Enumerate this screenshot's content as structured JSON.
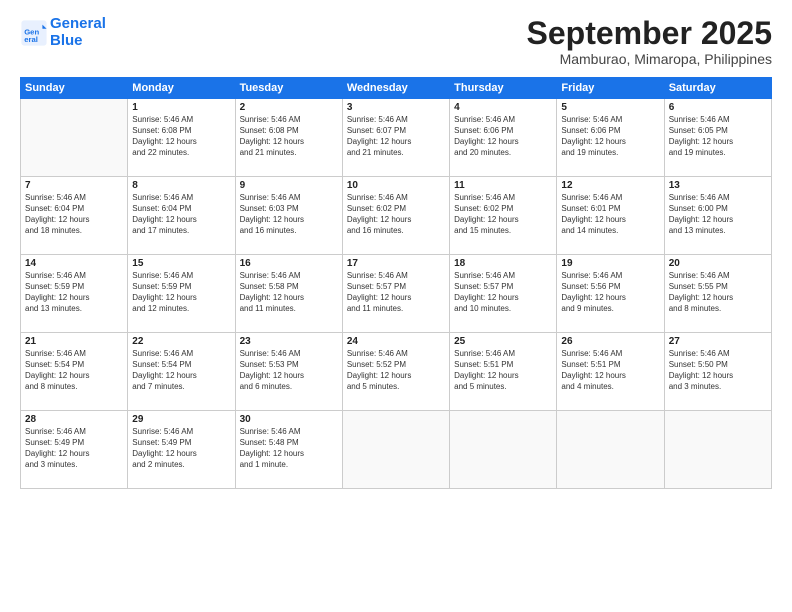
{
  "header": {
    "logo_line1": "General",
    "logo_line2": "Blue",
    "month": "September 2025",
    "location": "Mamburao, Mimaropa, Philippines"
  },
  "weekdays": [
    "Sunday",
    "Monday",
    "Tuesday",
    "Wednesday",
    "Thursday",
    "Friday",
    "Saturday"
  ],
  "weeks": [
    [
      {
        "day": "",
        "info": ""
      },
      {
        "day": "1",
        "info": "Sunrise: 5:46 AM\nSunset: 6:08 PM\nDaylight: 12 hours\nand 22 minutes."
      },
      {
        "day": "2",
        "info": "Sunrise: 5:46 AM\nSunset: 6:08 PM\nDaylight: 12 hours\nand 21 minutes."
      },
      {
        "day": "3",
        "info": "Sunrise: 5:46 AM\nSunset: 6:07 PM\nDaylight: 12 hours\nand 21 minutes."
      },
      {
        "day": "4",
        "info": "Sunrise: 5:46 AM\nSunset: 6:06 PM\nDaylight: 12 hours\nand 20 minutes."
      },
      {
        "day": "5",
        "info": "Sunrise: 5:46 AM\nSunset: 6:06 PM\nDaylight: 12 hours\nand 19 minutes."
      },
      {
        "day": "6",
        "info": "Sunrise: 5:46 AM\nSunset: 6:05 PM\nDaylight: 12 hours\nand 19 minutes."
      }
    ],
    [
      {
        "day": "7",
        "info": "Sunrise: 5:46 AM\nSunset: 6:04 PM\nDaylight: 12 hours\nand 18 minutes."
      },
      {
        "day": "8",
        "info": "Sunrise: 5:46 AM\nSunset: 6:04 PM\nDaylight: 12 hours\nand 17 minutes."
      },
      {
        "day": "9",
        "info": "Sunrise: 5:46 AM\nSunset: 6:03 PM\nDaylight: 12 hours\nand 16 minutes."
      },
      {
        "day": "10",
        "info": "Sunrise: 5:46 AM\nSunset: 6:02 PM\nDaylight: 12 hours\nand 16 minutes."
      },
      {
        "day": "11",
        "info": "Sunrise: 5:46 AM\nSunset: 6:02 PM\nDaylight: 12 hours\nand 15 minutes."
      },
      {
        "day": "12",
        "info": "Sunrise: 5:46 AM\nSunset: 6:01 PM\nDaylight: 12 hours\nand 14 minutes."
      },
      {
        "day": "13",
        "info": "Sunrise: 5:46 AM\nSunset: 6:00 PM\nDaylight: 12 hours\nand 13 minutes."
      }
    ],
    [
      {
        "day": "14",
        "info": "Sunrise: 5:46 AM\nSunset: 5:59 PM\nDaylight: 12 hours\nand 13 minutes."
      },
      {
        "day": "15",
        "info": "Sunrise: 5:46 AM\nSunset: 5:59 PM\nDaylight: 12 hours\nand 12 minutes."
      },
      {
        "day": "16",
        "info": "Sunrise: 5:46 AM\nSunset: 5:58 PM\nDaylight: 12 hours\nand 11 minutes."
      },
      {
        "day": "17",
        "info": "Sunrise: 5:46 AM\nSunset: 5:57 PM\nDaylight: 12 hours\nand 11 minutes."
      },
      {
        "day": "18",
        "info": "Sunrise: 5:46 AM\nSunset: 5:57 PM\nDaylight: 12 hours\nand 10 minutes."
      },
      {
        "day": "19",
        "info": "Sunrise: 5:46 AM\nSunset: 5:56 PM\nDaylight: 12 hours\nand 9 minutes."
      },
      {
        "day": "20",
        "info": "Sunrise: 5:46 AM\nSunset: 5:55 PM\nDaylight: 12 hours\nand 8 minutes."
      }
    ],
    [
      {
        "day": "21",
        "info": "Sunrise: 5:46 AM\nSunset: 5:54 PM\nDaylight: 12 hours\nand 8 minutes."
      },
      {
        "day": "22",
        "info": "Sunrise: 5:46 AM\nSunset: 5:54 PM\nDaylight: 12 hours\nand 7 minutes."
      },
      {
        "day": "23",
        "info": "Sunrise: 5:46 AM\nSunset: 5:53 PM\nDaylight: 12 hours\nand 6 minutes."
      },
      {
        "day": "24",
        "info": "Sunrise: 5:46 AM\nSunset: 5:52 PM\nDaylight: 12 hours\nand 5 minutes."
      },
      {
        "day": "25",
        "info": "Sunrise: 5:46 AM\nSunset: 5:51 PM\nDaylight: 12 hours\nand 5 minutes."
      },
      {
        "day": "26",
        "info": "Sunrise: 5:46 AM\nSunset: 5:51 PM\nDaylight: 12 hours\nand 4 minutes."
      },
      {
        "day": "27",
        "info": "Sunrise: 5:46 AM\nSunset: 5:50 PM\nDaylight: 12 hours\nand 3 minutes."
      }
    ],
    [
      {
        "day": "28",
        "info": "Sunrise: 5:46 AM\nSunset: 5:49 PM\nDaylight: 12 hours\nand 3 minutes."
      },
      {
        "day": "29",
        "info": "Sunrise: 5:46 AM\nSunset: 5:49 PM\nDaylight: 12 hours\nand 2 minutes."
      },
      {
        "day": "30",
        "info": "Sunrise: 5:46 AM\nSunset: 5:48 PM\nDaylight: 12 hours\nand 1 minute."
      },
      {
        "day": "",
        "info": ""
      },
      {
        "day": "",
        "info": ""
      },
      {
        "day": "",
        "info": ""
      },
      {
        "day": "",
        "info": ""
      }
    ]
  ]
}
